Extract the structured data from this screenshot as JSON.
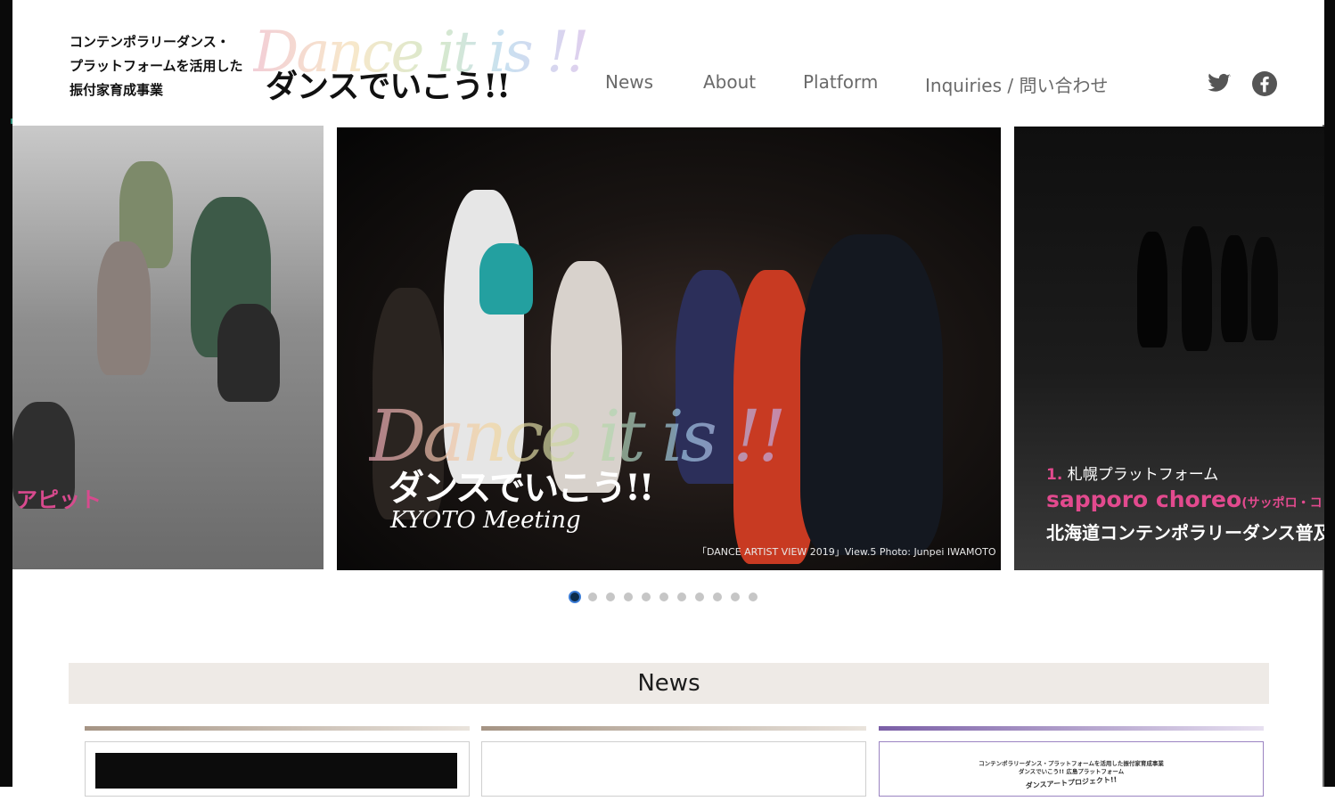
{
  "header": {
    "tagline_lines": [
      "コンテンポラリーダンス・",
      "プラットフォームを活用した",
      "振付家育成事業"
    ],
    "logo_script": "Dance it is !!",
    "logo_jp": "ダンスでいこう!!"
  },
  "nav": {
    "items": [
      {
        "label": "News"
      },
      {
        "label": "About"
      },
      {
        "label": "Platform"
      },
      {
        "label": "Inquiries / 問い合わせ"
      }
    ]
  },
  "social": {
    "twitter_icon": "twitter-icon",
    "facebook_icon": "facebook-icon"
  },
  "carousel": {
    "left_caption": "アピット",
    "center": {
      "script": "Dance it is !!",
      "jp": "ダンスでいこう!!",
      "subtitle": "KYOTO Meeting",
      "credit": "「DANCE ARTIST VIEW 2019」View.5  Photo: Junpei IWAMOTO"
    },
    "right": {
      "number": "1.",
      "title": "札幌プラットフォーム",
      "brand": "sapporo choreo",
      "brand_sub": "(サッポロ・コ",
      "desc": "北海道コンテンポラリーダンス普及"
    },
    "dot_count": 11,
    "active_dot": 1
  },
  "news": {
    "title": "News",
    "cards": [
      {
        "bar_color": "#b9a99a"
      },
      {
        "bar_color": "#b9a99a"
      },
      {
        "bar_color": "#8a6fb0",
        "lines": [
          "コンテンポラリーダンス・プラットフォームを活用した振付家育成事業",
          "ダンスでいこう!! 広島プラットフォーム",
          "ダンスアートプロジェクト!!"
        ]
      }
    ]
  },
  "colors": {
    "accent_pink": "#e24a8e",
    "nav_text": "#6a6a6a",
    "news_band": "#eeeae6",
    "active_dot": "#0b2b4a"
  }
}
